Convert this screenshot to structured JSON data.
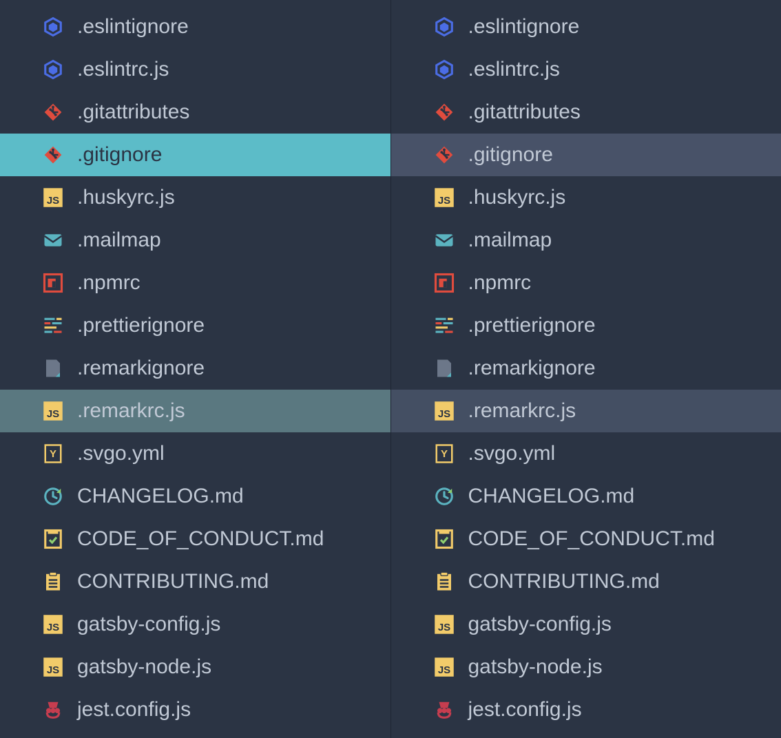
{
  "panes": [
    {
      "id": "left",
      "files": [
        {
          "name": ".eslintignore",
          "icon": "eslint",
          "state": "normal"
        },
        {
          "name": ".eslintrc.js",
          "icon": "eslint",
          "state": "normal"
        },
        {
          "name": ".gitattributes",
          "icon": "git",
          "state": "normal"
        },
        {
          "name": ".gitignore",
          "icon": "git",
          "state": "selected-left"
        },
        {
          "name": ".huskyrc.js",
          "icon": "js",
          "state": "normal"
        },
        {
          "name": ".mailmap",
          "icon": "mail",
          "state": "normal"
        },
        {
          "name": ".npmrc",
          "icon": "npm",
          "state": "normal"
        },
        {
          "name": ".prettierignore",
          "icon": "prettier",
          "state": "normal"
        },
        {
          "name": ".remarkignore",
          "icon": "file",
          "state": "normal"
        },
        {
          "name": ".remarkrc.js",
          "icon": "js",
          "state": "active-left"
        },
        {
          "name": ".svgo.yml",
          "icon": "yml",
          "state": "normal"
        },
        {
          "name": "CHANGELOG.md",
          "icon": "changelog",
          "state": "normal"
        },
        {
          "name": "CODE_OF_CONDUCT.md",
          "icon": "conduct",
          "state": "normal"
        },
        {
          "name": "CONTRIBUTING.md",
          "icon": "contributing",
          "state": "normal"
        },
        {
          "name": "gatsby-config.js",
          "icon": "js",
          "state": "normal"
        },
        {
          "name": "gatsby-node.js",
          "icon": "js",
          "state": "normal"
        },
        {
          "name": "jest.config.js",
          "icon": "jest",
          "state": "normal"
        }
      ]
    },
    {
      "id": "right",
      "files": [
        {
          "name": ".eslintignore",
          "icon": "eslint",
          "state": "normal"
        },
        {
          "name": ".eslintrc.js",
          "icon": "eslint",
          "state": "normal"
        },
        {
          "name": ".gitattributes",
          "icon": "git",
          "state": "normal"
        },
        {
          "name": ".gitignore",
          "icon": "git",
          "state": "selected-right"
        },
        {
          "name": ".huskyrc.js",
          "icon": "js",
          "state": "normal"
        },
        {
          "name": ".mailmap",
          "icon": "mail",
          "state": "normal"
        },
        {
          "name": ".npmrc",
          "icon": "npm",
          "state": "normal"
        },
        {
          "name": ".prettierignore",
          "icon": "prettier",
          "state": "normal"
        },
        {
          "name": ".remarkignore",
          "icon": "file",
          "state": "normal"
        },
        {
          "name": ".remarkrc.js",
          "icon": "js",
          "state": "active-right"
        },
        {
          "name": ".svgo.yml",
          "icon": "yml",
          "state": "normal"
        },
        {
          "name": "CHANGELOG.md",
          "icon": "changelog",
          "state": "normal"
        },
        {
          "name": "CODE_OF_CONDUCT.md",
          "icon": "conduct",
          "state": "normal"
        },
        {
          "name": "CONTRIBUTING.md",
          "icon": "contributing",
          "state": "normal"
        },
        {
          "name": "gatsby-config.js",
          "icon": "js",
          "state": "normal"
        },
        {
          "name": "gatsby-node.js",
          "icon": "js",
          "state": "normal"
        },
        {
          "name": "jest.config.js",
          "icon": "jest",
          "state": "normal"
        }
      ]
    }
  ],
  "icons": {
    "eslint": {
      "type": "hexagon",
      "stroke": "#4b6de5",
      "fill": "none"
    },
    "git": {
      "type": "diamond",
      "fill": "#e04c3e"
    },
    "js": {
      "type": "js",
      "bg": "#f2cb6a",
      "text": "JS"
    },
    "mail": {
      "type": "mail",
      "fill": "#5bb3c0"
    },
    "npm": {
      "type": "npm",
      "stroke": "#e04c3e"
    },
    "prettier": {
      "type": "prettier"
    },
    "file": {
      "type": "file",
      "fill": "#6c7789"
    },
    "yml": {
      "type": "yml",
      "stroke": "#f2cb6a"
    },
    "changelog": {
      "type": "refresh",
      "stroke": "#5bb3c0"
    },
    "conduct": {
      "type": "checklist",
      "stroke": "#f2cb6a"
    },
    "contributing": {
      "type": "clipboard",
      "fill": "#f2cb6a"
    },
    "jest": {
      "type": "jest",
      "fill": "#c63d4f"
    }
  }
}
